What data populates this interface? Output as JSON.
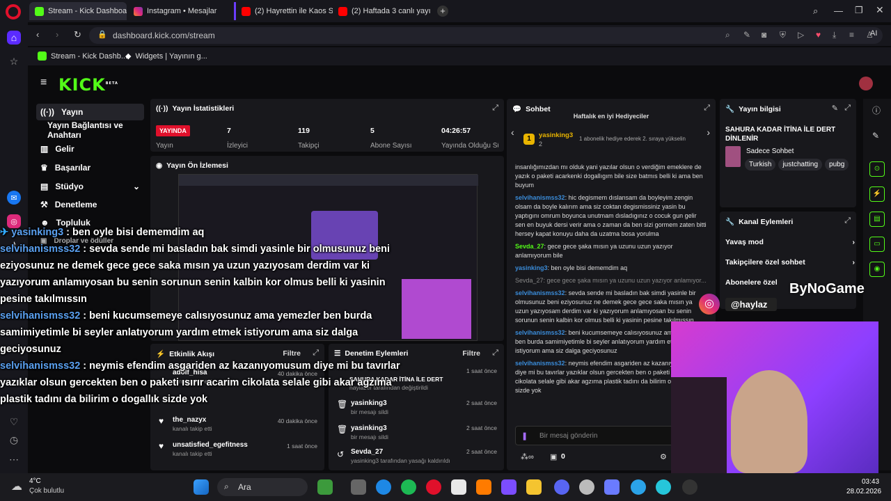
{
  "browser": {
    "tabs": [
      {
        "label": "Stream - Kick Dashboard",
        "active": true
      },
      {
        "label": "Instagram • Mesajlar"
      },
      {
        "label": "(2) Hayrettin ile Kaos Show"
      },
      {
        "label": "(2) Haftada 3 canlı yayın"
      }
    ],
    "url": "dashboard.kick.com/stream",
    "ai_label": "AI",
    "bookmarks": [
      "Stream - Kick Dashb...",
      "Widgets | Yayının g..."
    ]
  },
  "kick": {
    "logo": "KICK",
    "logo_badge": "BETA",
    "nav": [
      {
        "label": "Yayın",
        "icon": "broadcast-icon"
      },
      {
        "label": "Yayın Bağlantısı ve Anahtarı",
        "icon": ""
      },
      {
        "label": "Gelir",
        "icon": "chart-icon"
      },
      {
        "label": "Başarılar",
        "icon": "trophy-icon"
      },
      {
        "label": "Stüdyo",
        "icon": "studio-icon"
      },
      {
        "label": "Denetleme",
        "icon": "hammer-icon"
      },
      {
        "label": "Topluluk",
        "icon": "people-icon"
      },
      {
        "label": "Droplar ve ödüller",
        "icon": "gift-icon"
      }
    ],
    "stats": {
      "title": "Yayın İstatistikleri",
      "live_badge": "YAYINDA",
      "live_label": "Yayın",
      "items": [
        {
          "value": "7",
          "label": "İzleyici"
        },
        {
          "value": "119",
          "label": "Takipçi"
        },
        {
          "value": "5",
          "label": "Abone Sayısı"
        },
        {
          "value": "04:26:57",
          "label": "Yayında Olduğu Süre"
        }
      ]
    },
    "preview": {
      "title": "Yayın Ön İzlemesi"
    },
    "activity": {
      "title": "Etkinlik Akışı",
      "filter": "Filtre",
      "items": [
        {
          "name": "adolf_hisa",
          "sub": "kanalı takip etti",
          "time": "40 dakika önce"
        },
        {
          "name": "the_nazyx",
          "sub": "kanalı takip etti",
          "time": "40 dakika önce"
        },
        {
          "name": "unsatisfied_egefitness",
          "sub": "kanalı takip etti",
          "time": "1 saat önce"
        }
      ]
    },
    "moderation": {
      "title": "Denetim Eylemleri",
      "filter": "Filtre",
      "items": [
        {
          "name": "SAHURA KADAR İTİNA İLE DERT",
          "sub": "haylazer tarafından değiştirildi",
          "time": "1 saat önce"
        },
        {
          "name": "yasinking3",
          "sub": "bir mesajı sildi",
          "time": "2 saat önce"
        },
        {
          "name": "yasinking3",
          "sub": "bir mesajı sildi",
          "time": "2 saat önce"
        },
        {
          "name": "Sevda_27",
          "sub": "yasinking3 tarafından yasağı kaldırıldı",
          "time": "2 saat önce"
        }
      ]
    },
    "chat": {
      "title": "Sohbet",
      "gifter_heading": "Haftalık en iyi Hediyeciler",
      "gifter_name": "yasinking3",
      "gifter_count": "2",
      "gifter_note": "1 abonelik hediye ederek 2. sıraya yükselin",
      "messages": [
        {
          "user": "",
          "text": "insanlığımızdan mı olduk yani yazılar olsun o verdiğim emeklere de yazık o paketi acarkenki dogallıgım bile size batmıs belli ki ama ben buyum"
        },
        {
          "user": "selvihanismss32",
          "text": ": hic degismem dıslansam da boyleyim zengin olsam da boyle kalırım ama siz coktan degismissiniz yasin bu yaptıgını omrum boyunca unutmam dısladıgınız o cocuk gun gelir sen en buyuk dersi verir ama o zaman da ben sizi gormem zaten bitti hersey kapat konuyu daha da uzatma bosa yorulma"
        },
        {
          "user": "Sevda_27",
          "text": ": gece gece şaka mısın ya uzunu uzun yazıyor anlamıyorum bile"
        },
        {
          "user": "yasinking3",
          "text": ": ben oyle bisi dememdim aq"
        },
        {
          "user": "",
          "text": "Sevda_27: gece gece şaka mısın ya uzunu uzun yazıyor anlamıyor..."
        },
        {
          "user": "selvihanismss32",
          "text": ": sevda sende mi basladın bak simdi yasinle bir olmusunuz beni eziyosunuz ne demek gece gece saka mısın ya uzun yazıyosam derdim var ki yazıyorum anlamıyosan bu senin sorunun senin kalbin kor olmus belli ki yasinin pesine takılmıssın"
        },
        {
          "user": "selvihanismss32",
          "text": ": beni kucumsemeye calısıyosunuz ama yemezler ben burda samimiyetimle bi seyler anlatıyorum yardım etmek istiyorum ama siz dalga geciyosunuz"
        },
        {
          "user": "selvihanismss32",
          "text": ": neymis efendim asgariden az kazanıyomusum diye mi bu tavırlar yazıklar olsun gercekten ben o paketi ısırır acarim cikolata selale gibi akar agzıma plastik tadını da bilirim o dogallık sizde yok"
        }
      ],
      "input_placeholder": "Bir mesaj gönderin",
      "points": "0"
    },
    "stream_info": {
      "title": "Yayın bilgisi",
      "stream_title": "SAHURA KADAR İTİNA İLE DERT DİNLENİR",
      "category": "Sadece Sohbet",
      "tags": [
        "Turkish",
        "justchatting",
        "pubg"
      ]
    },
    "channel_actions": {
      "title": "Kanal Eylemleri",
      "items": [
        "Yavaş mod",
        "Takipçilere özel sohbet",
        "Abonelere özel"
      ]
    }
  },
  "overlay": {
    "chat": [
      {
        "user": "yasinking3",
        "text": " : ben oyle bisi dememdim aq"
      },
      {
        "user": "selvihanismss32",
        "text": " : sevda sende mi basladın bak simdi yasinle bir olmusunuz beni eziyosunuz ne demek gece gece saka mısın ya uzun yazıyosam derdim var ki yazıyorum anlamıyosan bu senin sorunun senin kalbin kor olmus belli ki yasinin pesine takılmıssın"
      },
      {
        "user": "selvihanismss32",
        "text": " : beni kucumsemeye calısıyosunuz ama yemezler ben burda samimiyetimle bi seyler anlatıyorum yardım etmek istiyorum ama siz dalga geciyosunuz"
      },
      {
        "user": "selvihanismss32",
        "text": " : neymis efendim asgariden az kazanıyomusum diye mi bu tavırlar yazıklar olsun gercekten ben o paketi ısırır acarim cikolata selale gibi akar agzıma plastik tadını da bilirim o dogallık sizde yok"
      }
    ],
    "instagram_handle": "@haylaz",
    "brand": "ByNoGame"
  },
  "taskbar": {
    "weather_temp": "4°C",
    "weather_desc": "Çok bulutlu",
    "search": "Ara",
    "time": "03:43",
    "date": "28.02.2026"
  },
  "colors": {
    "kick_green": "#53fc18",
    "live_red": "#e0102b",
    "username_blue": "#3a8bd8"
  }
}
